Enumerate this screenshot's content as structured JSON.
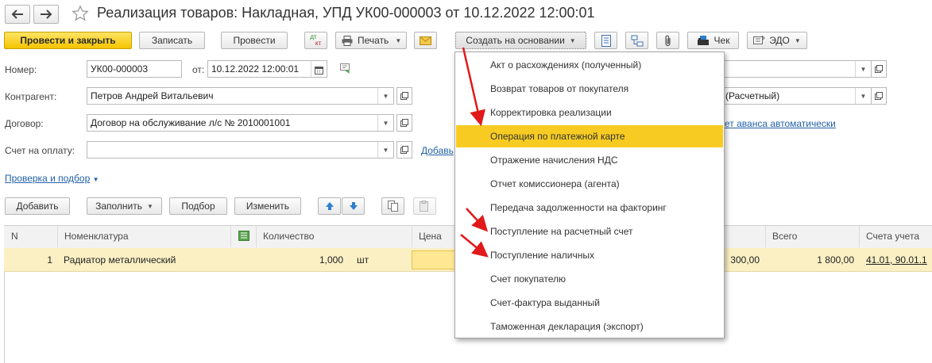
{
  "window": {
    "title": "Реализация товаров: Накладная, УПД УК00-000003 от 10.12.2022 12:00:01"
  },
  "toolbar": {
    "post_close": "Провести и закрыть",
    "save": "Записать",
    "post": "Провести",
    "dtkt_top": "дт",
    "dtkt_bottom": "кт",
    "print": "Печать",
    "create_based": "Создать на основании",
    "check": "Чек",
    "edo": "ЭДО"
  },
  "form": {
    "number_label": "Номер:",
    "number_value": "УК00-000003",
    "from_label": "от:",
    "date_value": "10.12.2022 12:00:01",
    "counterparty_label": "Контрагент:",
    "counterparty_value": "Петров Андрей Витальевич",
    "contract_label": "Договор:",
    "contract_value": "Договор на обслуживание л/с № 2010001001",
    "invoice_label": "Счет на оплату:",
    "invoice_value": "",
    "add_link": "Добавь",
    "right_field_2": "(Расчетный)",
    "advance_link": "ет аванса автоматически",
    "check_link": "Проверка и подбор"
  },
  "table_toolbar": {
    "add": "Добавить",
    "fill": "Заполнить",
    "select": "Подбор",
    "change": "Изменить"
  },
  "table": {
    "headers": [
      "N",
      "Номенклатура",
      "Количество",
      "Цена",
      "Всего",
      "Счета учета"
    ],
    "rows": [
      {
        "n": "1",
        "item": "Радиатор металлический",
        "qty": "1,000",
        "unit": "шт",
        "price": "",
        "sum_partial": "300,00",
        "total": "1 800,00",
        "accounts": "41.01, 90.01.1"
      }
    ]
  },
  "menu": {
    "items": [
      "Акт о расхождениях (полученный)",
      "Возврат товаров от покупателя",
      "Корректировка реализации",
      "Операция по платежной карте",
      "Отражение начисления НДС",
      "Отчет комиссионера (агента)",
      "Передача задолженности на факторинг",
      "Поступление на расчетный счет",
      "Поступление наличных",
      "Счет покупателю",
      "Счет-фактура выданный",
      "Таможенная декларация (экспорт)"
    ],
    "selected_index": 3
  },
  "colors": {
    "primary": "#f5c400",
    "selected_row": "#fbf0c4",
    "link": "#2261a8",
    "arrow": "#e01a1a"
  }
}
